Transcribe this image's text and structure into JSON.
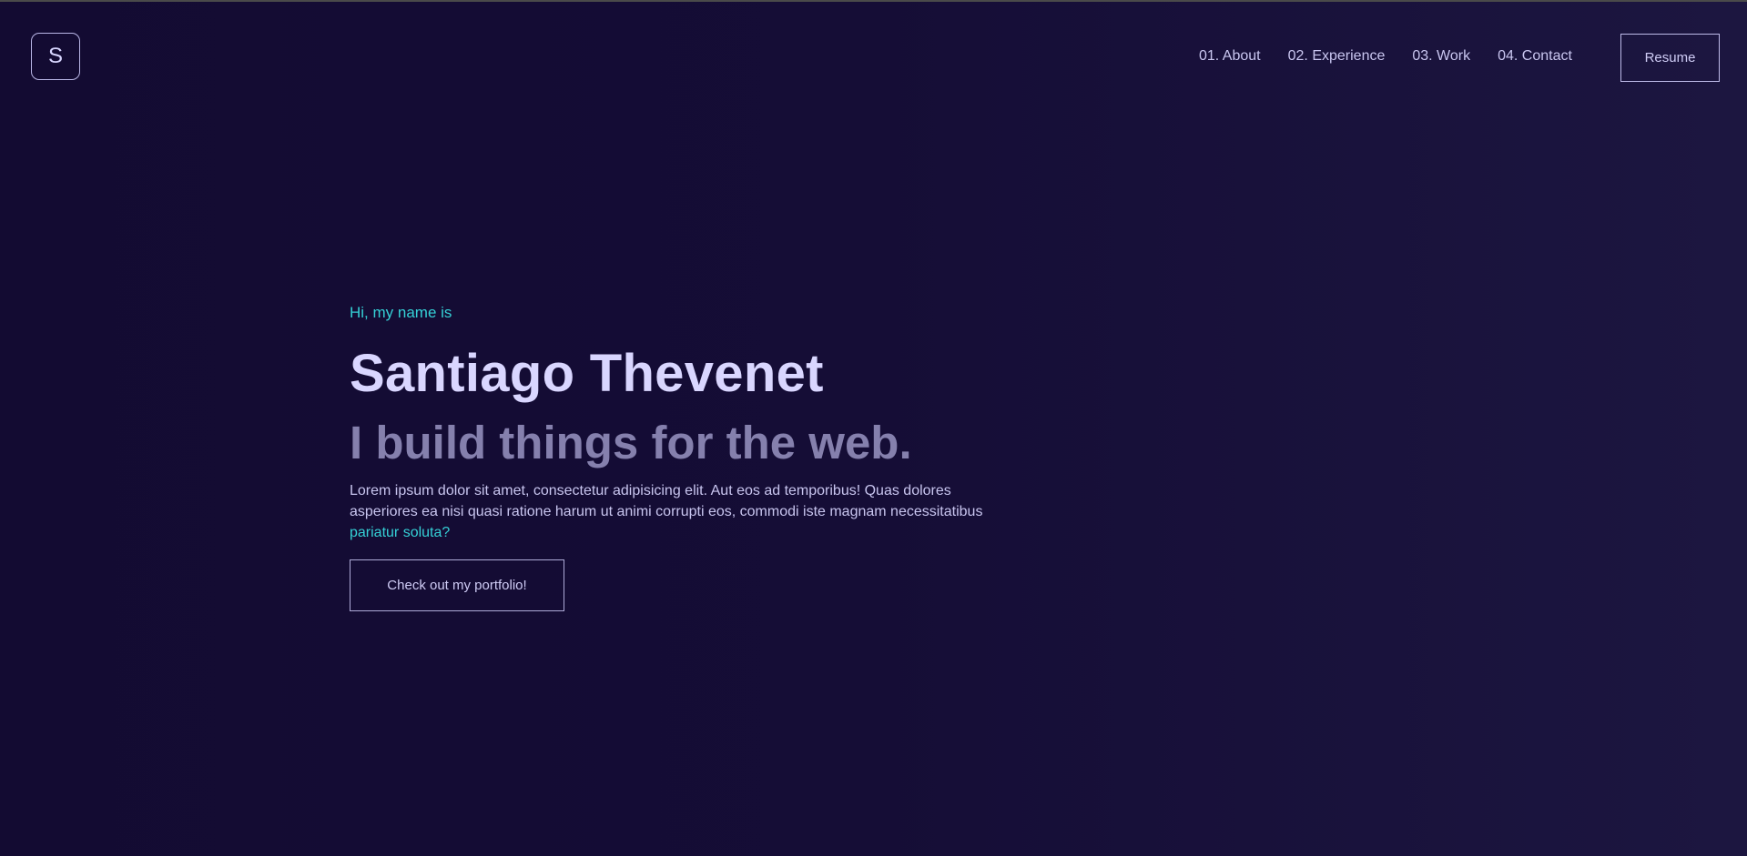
{
  "header": {
    "logo_letter": "S",
    "nav": [
      {
        "label": "01. About"
      },
      {
        "label": "02. Experience"
      },
      {
        "label": "03. Work"
      },
      {
        "label": "04. Contact"
      }
    ],
    "resume_label": "Resume"
  },
  "hero": {
    "greeting": "Hi, my name is",
    "name": "Santiago Thevenet",
    "tagline": "I build things for the web.",
    "description": "Lorem ipsum dolor sit amet, consectetur adipisicing elit. Aut eos ad temporibus! Quas dolores asperiores ea nisi quasi ratione harum ut animi corrupti eos, commodi iste magnam necessitatibus",
    "description_link": "pariatur soluta?",
    "cta_label": "Check out my portfolio!"
  },
  "colors": {
    "background": "#150d36",
    "accent": "#35d0d6",
    "heading": "#d9d6ff",
    "muted": "#8580ad"
  }
}
